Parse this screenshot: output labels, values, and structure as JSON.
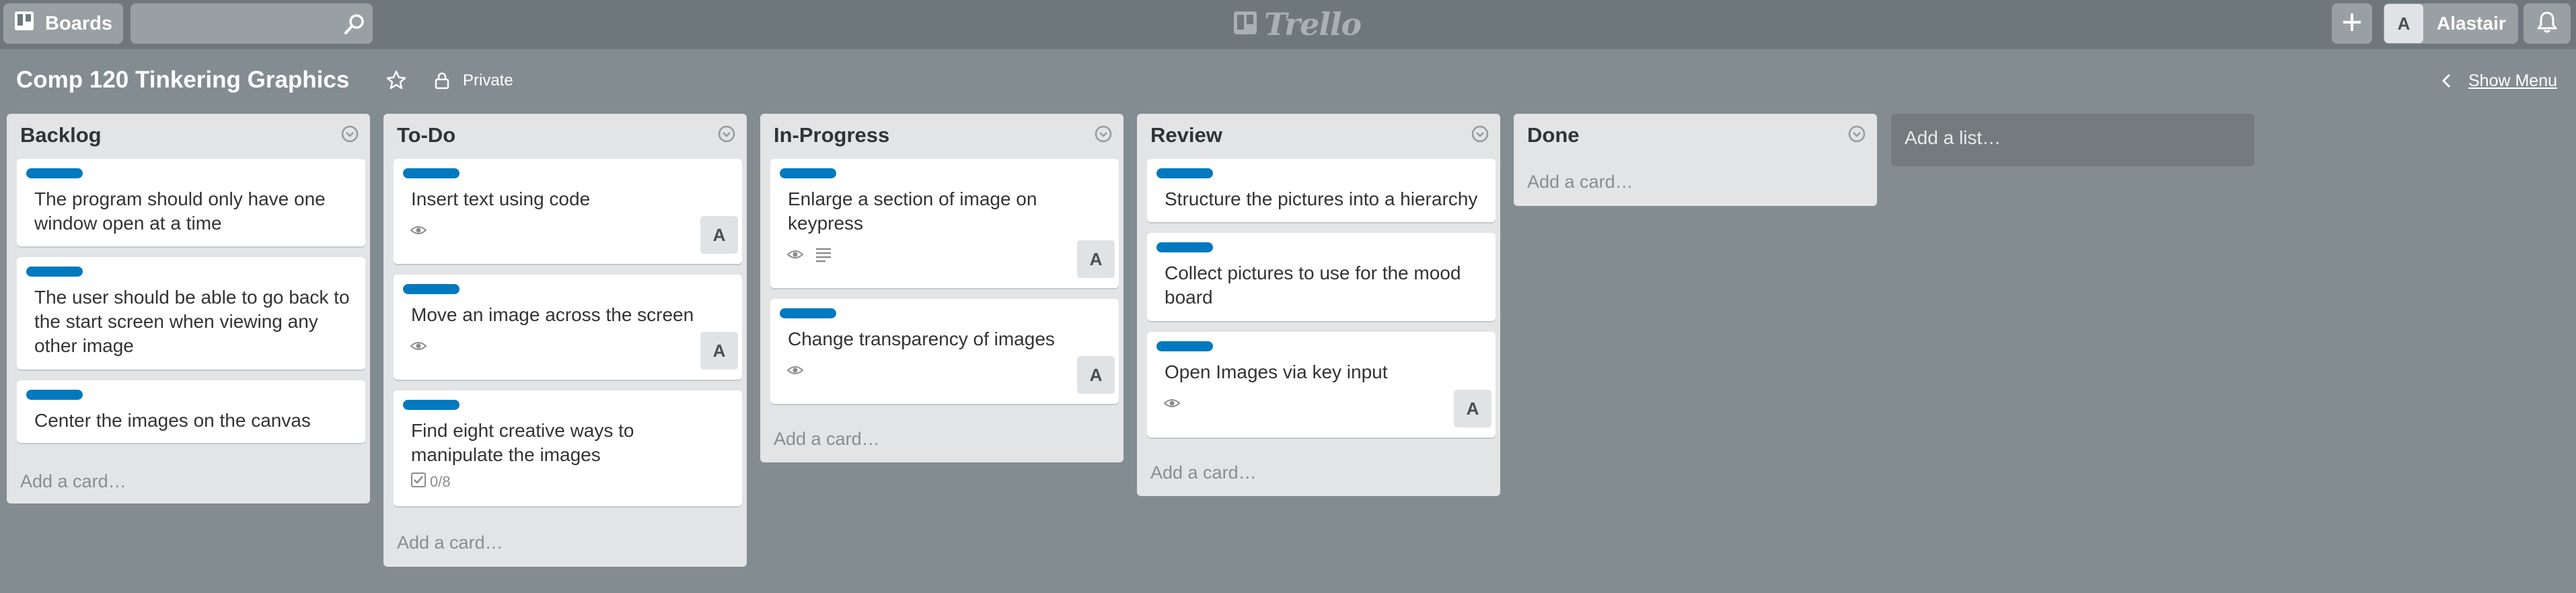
{
  "header": {
    "boards_label": "Boards",
    "search": {
      "value": "",
      "placeholder": ""
    },
    "logo_text": "Trello",
    "user": {
      "avatar_initial": "A",
      "name": "Alastair"
    },
    "icons": [
      "boards-icon",
      "search-icon",
      "trello-logo-icon",
      "plus-icon",
      "bell-icon"
    ]
  },
  "board": {
    "title": "Comp 120 Tinkering Graphics",
    "visibility": "Private",
    "show_menu_label": "Show Menu"
  },
  "colors": {
    "background": "#838c91",
    "header": "#6e777c",
    "list": "#e2e4e6",
    "label": "#0079bf"
  },
  "lists": [
    {
      "title": "Backlog",
      "cards": [
        {
          "title": "The program should only have one window open at a time"
        },
        {
          "title": "The user should be able to go back to the start screen when viewing any other image"
        },
        {
          "title": "Center the images on the canvas"
        }
      ],
      "add_card_label": "Add a card…"
    },
    {
      "title": "To-Do",
      "cards": [
        {
          "title": "Insert text using code",
          "member": "A"
        },
        {
          "title": "Move an image across the screen",
          "member": "A"
        },
        {
          "title": "Find eight creative ways to manipulate the images",
          "checklist": "0/8"
        }
      ],
      "add_card_label": "Add a card…"
    },
    {
      "title": "In-Progress",
      "cards": [
        {
          "title": "Enlarge a section of image on keypress",
          "member": "A"
        },
        {
          "title": "Change transparency of images",
          "member": "A"
        }
      ],
      "add_card_label": "Add a card…"
    },
    {
      "title": "Review",
      "cards": [
        {
          "title": "Structure the pictures into a hierarchy"
        },
        {
          "title": "Collect pictures to use for the mood board"
        },
        {
          "title": "Open Images via key input",
          "member": "A"
        }
      ],
      "add_card_label": "Add a card…"
    },
    {
      "title": "Done",
      "cards": [],
      "add_card_label": "Add a card…"
    }
  ],
  "add_list_label": "Add a list…"
}
